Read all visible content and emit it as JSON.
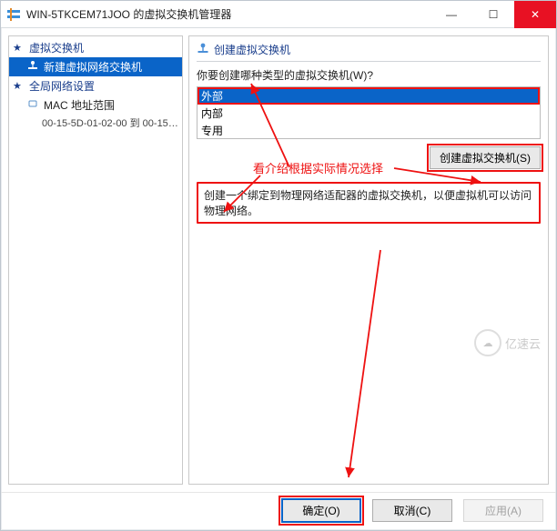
{
  "titlebar": {
    "icon": "switch",
    "title": "WIN-5TKCEM71JOO 的虚拟交换机管理器"
  },
  "window_controls": {
    "min": "—",
    "max": "☐",
    "close": "✕"
  },
  "tree": {
    "root1": {
      "label": "虚拟交换机"
    },
    "selected": {
      "label": "新建虚拟网络交换机"
    },
    "root2": {
      "label": "全局网络设置"
    },
    "mac_scope": {
      "label": "MAC 地址范围"
    },
    "mac_detail": "00-15-5D-01-02-00 到 00-15-5D-0..."
  },
  "right": {
    "section": "创建虚拟交换机",
    "prompt": "你要创建哪种类型的虚拟交换机(W)?",
    "types": {
      "t1": "外部",
      "t2": "内部",
      "t3": "专用"
    },
    "create_btn": "创建虚拟交换机(S)",
    "description": "创建一个绑定到物理网络适配器的虚拟交换机，以便虚拟机可以访问物理网络。"
  },
  "annotation": {
    "text": "看介绍根据实际情况选择"
  },
  "buttons": {
    "ok": "确定(O)",
    "cancel": "取消(C)",
    "apply": "应用(A)"
  },
  "watermark": "亿速云",
  "colors": {
    "accent": "#0a64c8",
    "danger": "#e11"
  }
}
